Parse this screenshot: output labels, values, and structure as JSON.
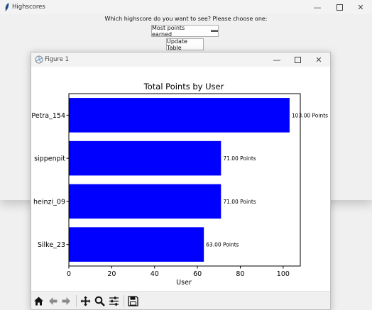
{
  "main_window": {
    "title": "Highscores",
    "prompt": "Which highscore do you want to see? Please choose one:",
    "dropdown_value": "Most points earned",
    "update_button": "Update Table"
  },
  "figure_window": {
    "title": "Figure 1"
  },
  "chart_data": {
    "type": "bar",
    "orientation": "horizontal",
    "title": "Total Points by User",
    "xlabel": "User",
    "ylabel": "",
    "categories": [
      "Petra_154",
      "sippenpit",
      "heinzi_09",
      "Silke_23"
    ],
    "values": [
      103,
      71,
      71,
      63
    ],
    "data_labels": [
      "103.00 Points",
      "71.00 Points",
      "71.00 Points",
      "63.00 Points"
    ],
    "xlim": [
      0,
      108
    ],
    "xticks": [
      0,
      20,
      40,
      60,
      80,
      100
    ],
    "bar_color": "#0000ff",
    "grid": false
  },
  "toolbar": {
    "tools": [
      "home-icon",
      "back-icon",
      "forward-icon",
      "pan-icon",
      "zoom-icon",
      "configure-icon",
      "save-icon"
    ]
  }
}
